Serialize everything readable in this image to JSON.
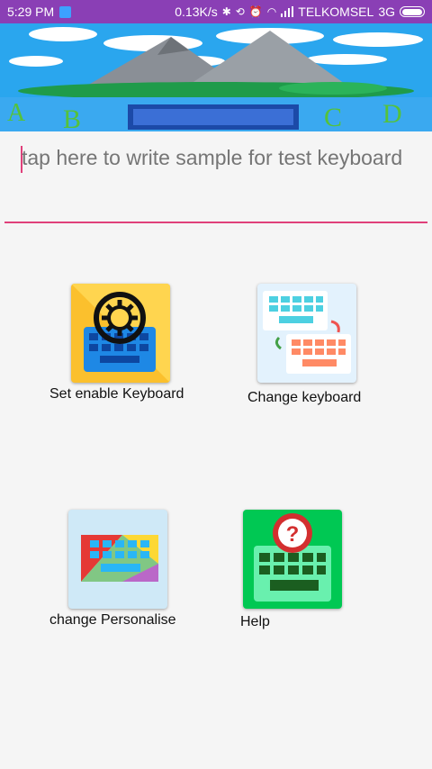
{
  "status_bar": {
    "time": "5:29 PM",
    "speed": "0.13K/s",
    "carrier": "TELKOMSEL",
    "network": "3G"
  },
  "banner": {
    "letters": [
      "A",
      "B",
      "C",
      "D"
    ],
    "colors": {
      "sky": "#2aa6ee",
      "mountain": "#8a8f96",
      "land": "#1f9b4a",
      "letters": "#55c23a"
    }
  },
  "input": {
    "placeholder": "tap here to write sample for test keyboard"
  },
  "tiles": [
    {
      "label": "Set enable Keyboard",
      "icon": "gear-keyboard-icon"
    },
    {
      "label": "Change keyboard",
      "icon": "switch-keyboard-icon"
    },
    {
      "label": "change Personalise",
      "icon": "colorful-keyboard-icon"
    },
    {
      "label": "Help",
      "icon": "help-keyboard-icon"
    }
  ],
  "colors": {
    "status_bar": "#8a3fb5",
    "accent": "#e0407a",
    "background": "#f5f5f5"
  }
}
